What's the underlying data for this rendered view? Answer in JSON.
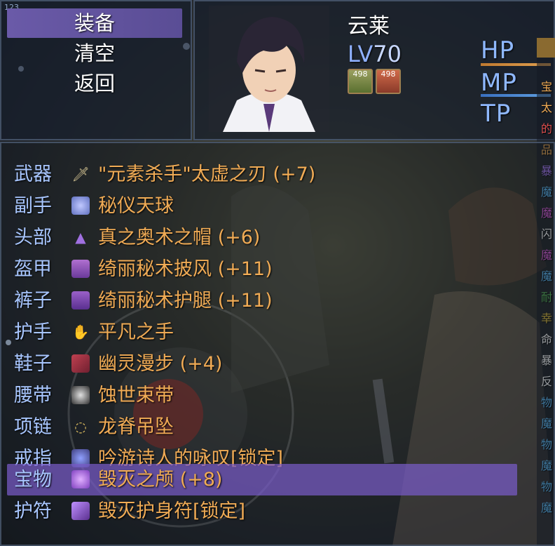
{
  "version_label": "123",
  "commands": [
    {
      "label": "装备",
      "selected": true
    },
    {
      "label": "清空",
      "selected": false
    },
    {
      "label": "返回",
      "selected": false
    }
  ],
  "actor": {
    "name": "云莱",
    "level_tag": "LV",
    "level": "70",
    "buff_icons": [
      {
        "icon": "leaf-buff-icon",
        "value": "498"
      },
      {
        "icon": "sword-buff-icon",
        "value": "498"
      }
    ],
    "gauges": [
      {
        "label": "HP",
        "color": "#e0a050"
      },
      {
        "label": "MP",
        "color": "#60a0e0"
      },
      {
        "label": "TP",
        "color": "#8fb8ff"
      }
    ]
  },
  "equipment_slots": [
    {
      "slot": "武器",
      "item": "\"元素杀手\"太虚之刃 (+7)",
      "icon": "sword-icon",
      "selected": false
    },
    {
      "slot": "副手",
      "item": "秘仪天球",
      "icon": "orb-icon",
      "selected": false
    },
    {
      "slot": "头部",
      "item": "真之奥术之帽 (+6)",
      "icon": "wizard-hat-icon",
      "selected": false
    },
    {
      "slot": "盔甲",
      "item": "绮丽秘术披风 (+11)",
      "icon": "cloak-icon",
      "selected": false
    },
    {
      "slot": "裤子",
      "item": "绮丽秘术护腿 (+11)",
      "icon": "pants-icon",
      "selected": false
    },
    {
      "slot": "护手",
      "item": "平凡之手",
      "icon": "glove-icon",
      "selected": false
    },
    {
      "slot": "鞋子",
      "item": "幽灵漫步 (+4)",
      "icon": "boots-icon",
      "selected": false
    },
    {
      "slot": "腰带",
      "item": "蚀世束带",
      "icon": "belt-icon",
      "selected": false
    },
    {
      "slot": "项链",
      "item": "龙脊吊坠",
      "icon": "necklace-icon",
      "selected": false
    },
    {
      "slot": "戒指",
      "item": "吟游诗人的咏叹[锁定]",
      "icon": "ring-icon",
      "selected": false
    },
    {
      "slot": "宝物",
      "item": "毁灭之颅 (+8)",
      "icon": "skull-icon",
      "selected": true
    },
    {
      "slot": "护符",
      "item": "毁灭护身符[锁定]",
      "icon": "amulet-icon",
      "selected": false
    }
  ],
  "colors": {
    "slot_label": "#a8c6ff",
    "item_name": "#f0ab55",
    "selection": "#6a5aa8"
  }
}
